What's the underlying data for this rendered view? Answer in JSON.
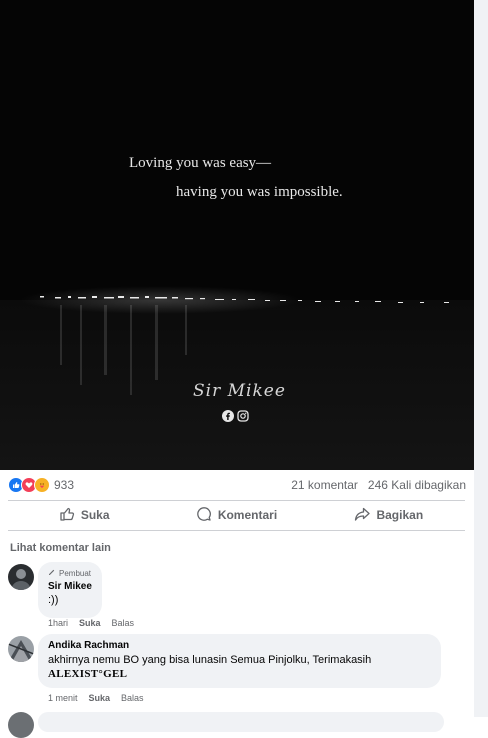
{
  "post": {
    "quote_line1": "Loving you was easy—",
    "quote_line2": "having you was impossible.",
    "signature": "Sir Mikee"
  },
  "icons": {
    "social": [
      "facebook-icon",
      "instagram-icon"
    ],
    "reactions": [
      "like-icon",
      "love-icon",
      "care-icon"
    ]
  },
  "stats": {
    "reaction_count": "933",
    "comments": "21 komentar",
    "shares": "246 Kali dibagikan"
  },
  "actions": {
    "like": "Suka",
    "comment": "Komentari",
    "share": "Bagikan"
  },
  "more_comments": "Lihat komentar lain",
  "comments": [
    {
      "badge": "Pembuat",
      "author": "Sir Mikee",
      "text": ":))",
      "time": "1hari",
      "like": "Suka",
      "reply": "Balas"
    },
    {
      "author": "Andika Rachman",
      "text": "akhirnya nemu BO yang bisa lunasin Semua Pinjolku, Terimakasih",
      "mention": "ALEXIST°GEL",
      "time": "1 menit",
      "like": "Suka",
      "reply": "Balas"
    }
  ],
  "colors": {
    "like": "#1877f2",
    "love": "#f33e58",
    "care": "#f7b125",
    "muted": "#65676b",
    "bubble": "#f0f2f5"
  }
}
